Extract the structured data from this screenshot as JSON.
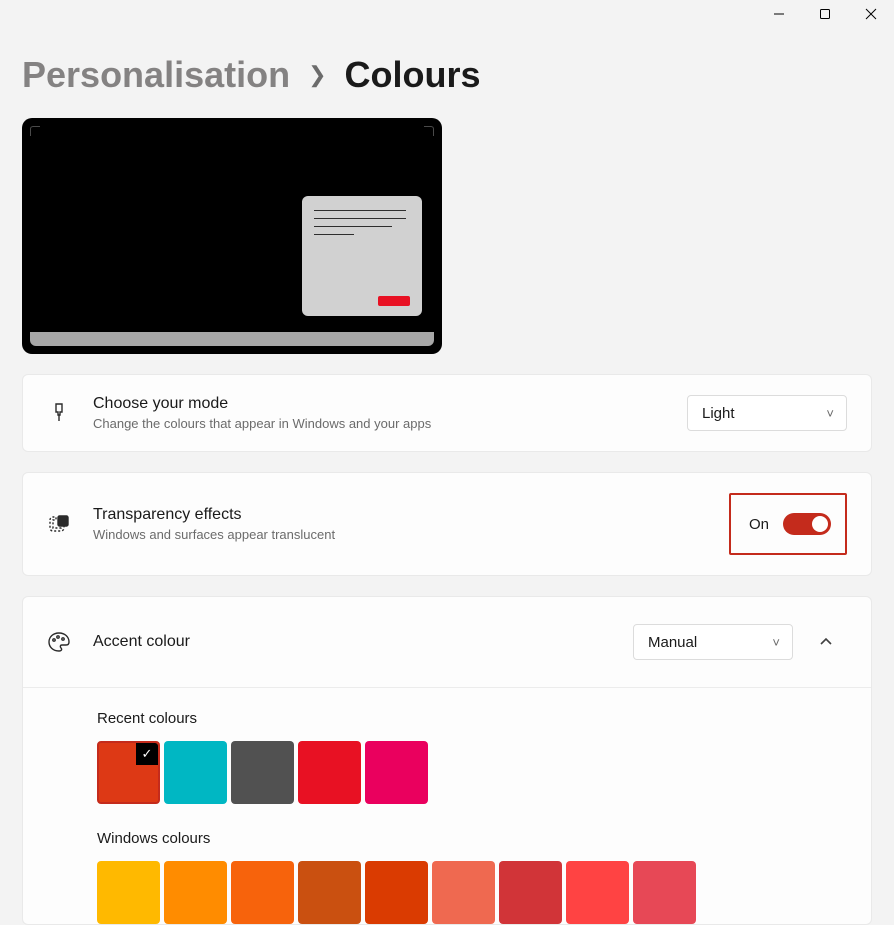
{
  "breadcrumb": {
    "parent": "Personalisation",
    "current": "Colours"
  },
  "mode": {
    "title": "Choose your mode",
    "subtitle": "Change the colours that appear in Windows and your apps",
    "selected": "Light"
  },
  "transparency": {
    "title": "Transparency effects",
    "subtitle": "Windows and surfaces appear translucent",
    "state_label": "On",
    "on": true
  },
  "accent": {
    "title": "Accent colour",
    "mode": "Manual",
    "recent_label": "Recent colours",
    "recent": [
      "#dd3915",
      "#00b7c3",
      "#515151",
      "#e81123",
      "#ea005e"
    ],
    "windows_label": "Windows colours",
    "windows": [
      "#ffb900",
      "#ff8c00",
      "#f7630c",
      "#ca5010",
      "#da3b01",
      "#ef6950",
      "#d13438",
      "#ff4343",
      "#e74856"
    ],
    "selected_index": 0
  },
  "preview_accent": "#e81123",
  "toggle_accent": "#c42b1c"
}
